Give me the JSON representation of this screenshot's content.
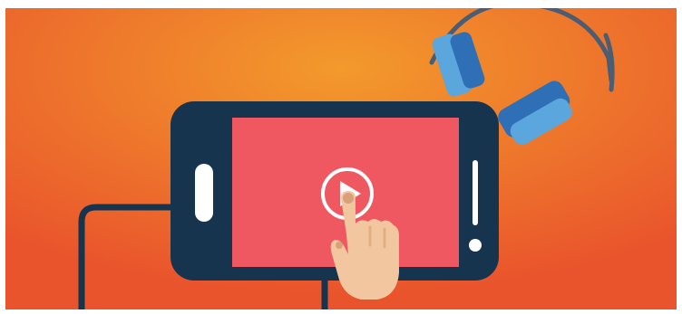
{
  "illustration": {
    "subject": "smartphone-video-playback",
    "icons": [
      "play-icon",
      "headphones-icon",
      "hand-pointer-icon"
    ],
    "colors": {
      "background_center": "#f39a2c",
      "background_edge": "#e9542c",
      "phone_body": "#17344f",
      "screen": "#ef5761",
      "play_ring": "#ffffff",
      "headphone_cushion": "#2f6fb6",
      "headphone_outer": "#5aa6dd",
      "skin": "#f2c79f",
      "cable": "#17344f"
    }
  }
}
